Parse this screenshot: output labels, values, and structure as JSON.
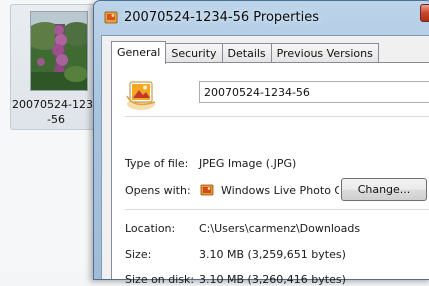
{
  "file_tile": {
    "caption": "20070524-1234-56"
  },
  "window": {
    "title": "20070524-1234-56 Properties"
  },
  "tabs": [
    {
      "label": "General",
      "active": true
    },
    {
      "label": "Security",
      "active": false
    },
    {
      "label": "Details",
      "active": false
    },
    {
      "label": "Previous Versions",
      "active": false
    }
  ],
  "general": {
    "file_name": "20070524-1234-56",
    "type_label": "Type of file:",
    "type_value": "JPEG Image (.JPG)",
    "opens_label": "Opens with:",
    "opens_value": "Windows Live Photo Gallery",
    "change_button": "Change...",
    "location_label": "Location:",
    "location_value": "C:\\Users\\carmenz\\Downloads",
    "size_label": "Size:",
    "size_value": "3.10 MB (3,259,651 bytes)",
    "size_on_disk_label": "Size on disk:",
    "size_on_disk_value": "3.10 MB (3,260,416 bytes)"
  },
  "icons": {
    "title": "photo-file-icon",
    "big": "jpeg-file-icon",
    "opens_with": "photo-gallery-icon"
  }
}
